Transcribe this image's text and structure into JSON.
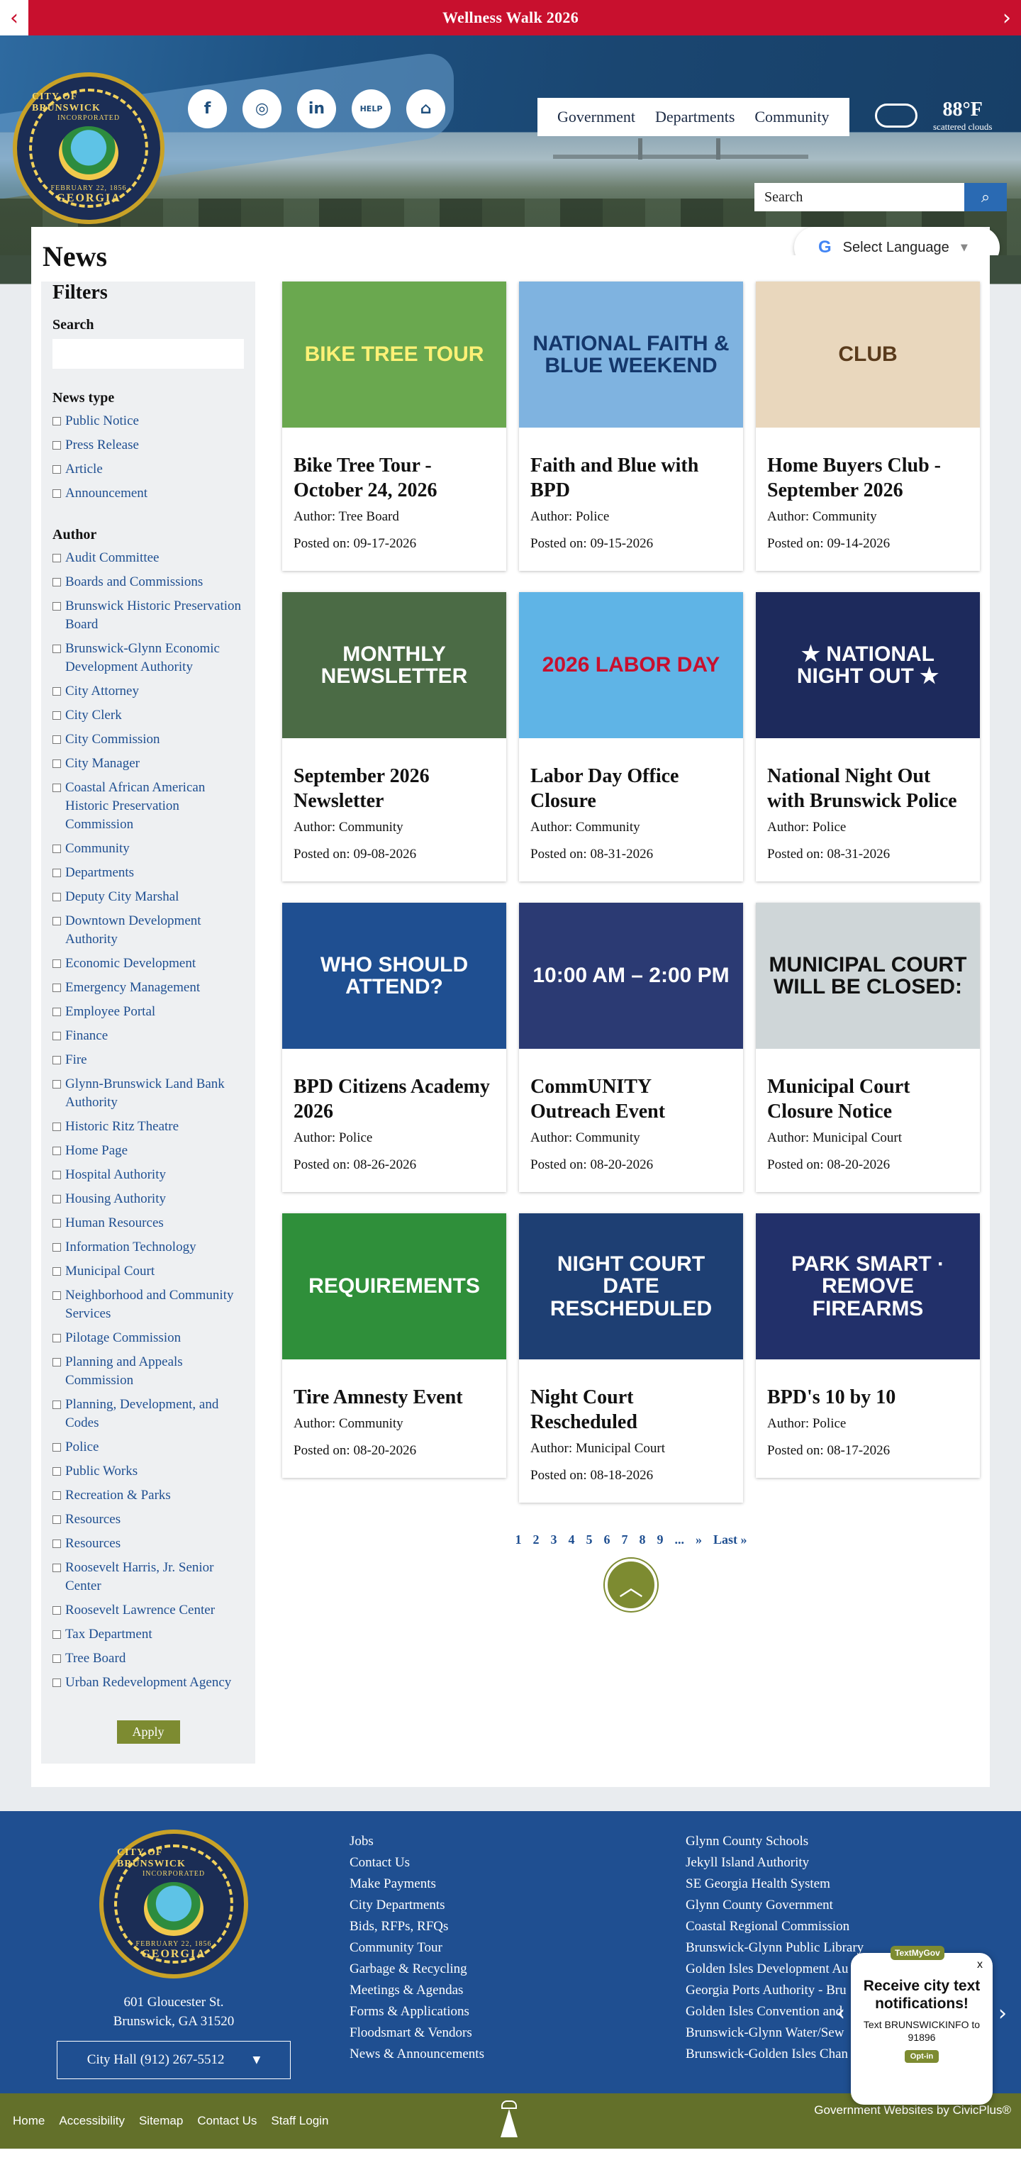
{
  "alert": {
    "title": "Wellness Walk 2026",
    "prev_icon": "chevron-left-icon",
    "next_icon": "chevron-right-icon"
  },
  "seal": {
    "name": "CITY OF BRUNSWICK",
    "incorporated": "INCORPORATED",
    "date": "FEBRUARY 22, 1856",
    "state": "GEORGIA"
  },
  "social": [
    {
      "icon": "facebook-icon",
      "glyph": "f"
    },
    {
      "icon": "instagram-icon",
      "glyph": "◎"
    },
    {
      "icon": "linkedin-icon",
      "glyph": "in"
    },
    {
      "icon": "help-icon",
      "glyph": "HELP"
    },
    {
      "icon": "home-icon",
      "glyph": "⌂"
    }
  ],
  "nav": [
    "Government",
    "Departments",
    "Community"
  ],
  "weather": {
    "temp": "88°F",
    "desc": "scattered clouds"
  },
  "search": {
    "placeholder": "Search",
    "button_icon": "search-icon"
  },
  "language": {
    "label": "Select Language",
    "caret": "▼"
  },
  "page_title": "News",
  "filters": {
    "title": "Filters",
    "search_label": "Search",
    "news_type_label": "News type",
    "news_types": [
      "Public Notice",
      "Press Release",
      "Article",
      "Announcement"
    ],
    "author_label": "Author",
    "authors": [
      "Audit Committee",
      "Boards and Commissions",
      "Brunswick Historic Preservation Board",
      "Brunswick-Glynn Economic Development Authority",
      "City Attorney",
      "City Clerk",
      "City Commission",
      "City Manager",
      "Coastal African American Historic Preservation Commission",
      "Community",
      "Departments",
      "Deputy City Marshal",
      "Downtown Development Authority",
      "Economic Development",
      "Emergency Management",
      "Employee Portal",
      "Finance",
      "Fire",
      "Glynn-Brunswick Land Bank Authority",
      "Historic Ritz Theatre",
      "Home Page",
      "Hospital Authority",
      "Housing Authority",
      "Human Resources",
      "Information Technology",
      "Municipal Court",
      "Neighborhood and Community Services",
      "Pilotage Commission",
      "Planning and Appeals Commission",
      "Planning, Development, and Codes",
      "Police",
      "Public Works",
      "Recreation & Parks",
      "Resources",
      "Resources",
      "Roosevelt Harris, Jr. Senior Center",
      "Roosevelt Lawrence Center",
      "Tax Department",
      "Tree Board",
      "Urban Redevelopment Agency"
    ],
    "apply_label": "Apply"
  },
  "news": [
    {
      "title": "Bike Tree Tour - October 24, 2026",
      "author": "Author: Tree Board",
      "date": "Posted on: 09-17-2026",
      "thumb_text": "BIKE TREE TOUR",
      "thumb_bg": "#6aa84f",
      "thumb_fg": "#fff176"
    },
    {
      "title": "Faith and Blue with BPD",
      "author": "Author: Police",
      "date": "Posted on: 09-15-2026",
      "thumb_text": "NATIONAL FAITH & BLUE WEEKEND",
      "thumb_bg": "#7fb3e0",
      "thumb_fg": "#14376b"
    },
    {
      "title": "Home Buyers Club - September 2026",
      "author": "Author: Community",
      "date": "Posted on: 09-14-2026",
      "thumb_text": "CLUB",
      "thumb_bg": "#e9d7bd",
      "thumb_fg": "#5a3b1c"
    },
    {
      "title": "September 2026 Newsletter",
      "author": "Author: Community",
      "date": "Posted on: 09-08-2026",
      "thumb_text": "MONTHLY NEWSLETTER",
      "thumb_bg": "#4b6b45",
      "thumb_fg": "#ffffff"
    },
    {
      "title": "Labor Day Office Closure",
      "author": "Author: Community",
      "date": "Posted on: 08-31-2026",
      "thumb_text": "2026 LABOR DAY",
      "thumb_bg": "#5fb4e6",
      "thumb_fg": "#c8102e"
    },
    {
      "title": "National Night Out with Brunswick Police",
      "author": "Author: Police",
      "date": "Posted on: 08-31-2026",
      "thumb_text": "★ NATIONAL NIGHT OUT ★",
      "thumb_bg": "#1d2a5c",
      "thumb_fg": "#ffffff"
    },
    {
      "title": "BPD Citizens Academy 2026",
      "author": "Author: Police",
      "date": "Posted on: 08-26-2026",
      "thumb_text": "WHO SHOULD ATTEND?",
      "thumb_bg": "#1f4f91",
      "thumb_fg": "#ffffff"
    },
    {
      "title": "CommUNITY Outreach Event",
      "author": "Author: Community",
      "date": "Posted on: 08-20-2026",
      "thumb_text": "10:00 AM – 2:00 PM",
      "thumb_bg": "#2b3a73",
      "thumb_fg": "#ffffff"
    },
    {
      "title": "Municipal Court Closure Notice",
      "author": "Author: Municipal Court",
      "date": "Posted on: 08-20-2026",
      "thumb_text": "MUNICIPAL COURT WILL BE CLOSED:",
      "thumb_bg": "#cfd6d8",
      "thumb_fg": "#111111"
    },
    {
      "title": "Tire Amnesty Event",
      "author": "Author: Community",
      "date": "Posted on: 08-20-2026",
      "thumb_text": "REQUIREMENTS",
      "thumb_bg": "#2f8f3a",
      "thumb_fg": "#ffffff"
    },
    {
      "title": "Night Court Rescheduled",
      "author": "Author: Municipal Court",
      "date": "Posted on: 08-18-2026",
      "thumb_text": "NIGHT COURT DATE RESCHEDULED",
      "thumb_bg": "#1e3f73",
      "thumb_fg": "#ffffff"
    },
    {
      "title": "BPD's 10 by 10",
      "author": "Author: Police",
      "date": "Posted on: 08-17-2026",
      "thumb_text": "PARK SMART · REMOVE FIREARMS",
      "thumb_bg": "#22306a",
      "thumb_fg": "#ffffff"
    }
  ],
  "pagination": [
    "1",
    "2",
    "3",
    "4",
    "5",
    "6",
    "7",
    "8",
    "9",
    "...",
    "»",
    "Last »"
  ],
  "to_top_icon": "chevron-up-icon",
  "footer": {
    "address_line1": "601 Gloucester St.",
    "address_line2": "Brunswick, GA 31520",
    "phone": "City Hall (912) 267-5512",
    "col1": [
      "Jobs",
      "Contact Us",
      "Make Payments",
      "City Departments",
      "Bids, RFPs, RFQs",
      "Community Tour",
      "Garbage & Recycling",
      "Meetings & Agendas",
      "Forms & Applications",
      "Floodsmart & Vendors",
      "News & Announcements"
    ],
    "col2": [
      "Glynn County Schools",
      "Jekyll Island Authority",
      "SE Georgia Health System",
      "Glynn County Government",
      "Coastal Regional Commission",
      "Brunswick-Glynn Public Library",
      "Golden Isles Development Au",
      "Georgia Ports Authority - Bru",
      "Golden Isles Convention and",
      "Brunswick-Glynn Water/Sew",
      "Brunswick-Golden Isles Chan"
    ]
  },
  "sms": {
    "brand": "TextMyGov",
    "close": "x",
    "heading": "Receive city text notifications!",
    "text": "Text BRUNSWICKINFO to 91896",
    "button": "Opt-in"
  },
  "bottom": {
    "links": [
      "Home",
      "Accessibility",
      "Sitemap",
      "Contact Us",
      "Staff Login"
    ],
    "credit": "Government Websites by CivicPlus®"
  }
}
